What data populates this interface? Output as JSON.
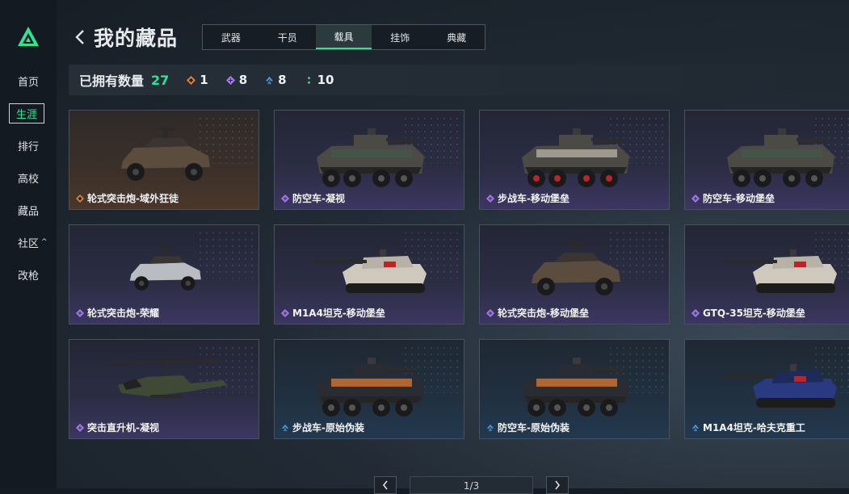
{
  "app": {
    "logo": "triangle-logo"
  },
  "sidebar": {
    "items": [
      {
        "label": "首页"
      },
      {
        "label": "生涯",
        "active": true
      },
      {
        "label": "排行"
      },
      {
        "label": "高校"
      },
      {
        "label": "藏品"
      },
      {
        "label": "社区",
        "caret": "^"
      },
      {
        "label": "改枪"
      }
    ]
  },
  "header": {
    "title": "我的藏品",
    "back_icon": "chevron-left-icon"
  },
  "tabs": [
    {
      "label": "武器"
    },
    {
      "label": "干员"
    },
    {
      "label": "载具",
      "active": true
    },
    {
      "label": "挂饰"
    },
    {
      "label": "典藏"
    }
  ],
  "stats": {
    "owned_label": "已拥有数量",
    "owned_count": "27",
    "rarities": [
      {
        "name": "orange",
        "color": "#d9823f",
        "count": "1"
      },
      {
        "name": "purple",
        "color": "#a77cf0",
        "count": "8"
      },
      {
        "name": "blue",
        "color": "#4a9be6",
        "count": "8"
      },
      {
        "name": "green",
        "color": "#3fd48c",
        "count": "10"
      }
    ]
  },
  "items": [
    {
      "name": "轮式突击炮-域外狂徒",
      "rarity": "orange",
      "vehicle": "buggy"
    },
    {
      "name": "防空车-凝视",
      "rarity": "purple",
      "vehicle": "apc"
    },
    {
      "name": "步战车-移动堡垒",
      "rarity": "purple",
      "vehicle": "apc-red"
    },
    {
      "name": "防空车-移动堡垒",
      "rarity": "purple",
      "vehicle": "apc"
    },
    {
      "name": "轮式突击炮-荣耀",
      "rarity": "purple",
      "vehicle": "buggy-small"
    },
    {
      "name": "M1A4坦克-移动堡垒",
      "rarity": "purple",
      "vehicle": "tank"
    },
    {
      "name": "轮式突击炮-移动堡垒",
      "rarity": "purple",
      "vehicle": "buggy"
    },
    {
      "name": "GTQ-35坦克-移动堡垒",
      "rarity": "purple",
      "vehicle": "tank"
    },
    {
      "name": "突击直升机-凝视",
      "rarity": "purple",
      "vehicle": "heli"
    },
    {
      "name": "步战车-原始伪装",
      "rarity": "blue",
      "vehicle": "apc-orange"
    },
    {
      "name": "防空车-原始伪装",
      "rarity": "blue",
      "vehicle": "apc-orange"
    },
    {
      "name": "M1A4坦克-哈夫克重工",
      "rarity": "blue",
      "vehicle": "tank-blue"
    }
  ],
  "pager": {
    "info": "1/3",
    "prev_icon": "chevron-left-icon",
    "next_icon": "chevron-right-icon"
  }
}
